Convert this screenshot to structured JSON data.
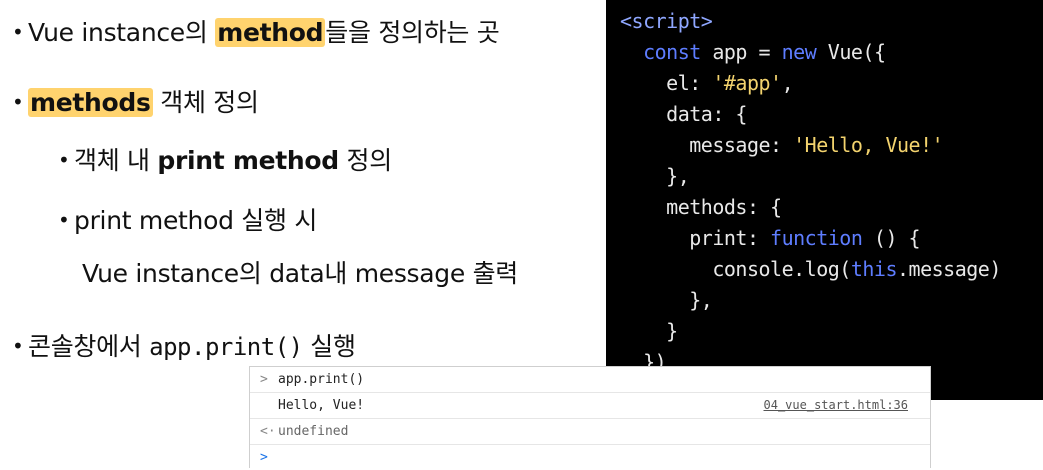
{
  "bullets": {
    "b1_pre": "Vue instance의 ",
    "b1_hl": "method",
    "b1_post": "들을 정의하는 곳",
    "b2_hl": "methods",
    "b2_post": " 객체 정의",
    "b3_pre": "객체 내 ",
    "b3_bold": "print method",
    "b3_post": " 정의",
    "b4": "print method 실행 시",
    "b4_cont": "Vue instance의 data내 message 출력",
    "b5_pre": "콘솔창에서 ",
    "b5_code": "app.print()",
    "b5_post": " 실행"
  },
  "code": {
    "l1": "<script>",
    "l2_kw1": "const",
    "l2_mid": " app = ",
    "l2_kw2": "new",
    "l2_end": " Vue({",
    "l3_key": "el: ",
    "l3_str": "'#app'",
    "l3_end": ",",
    "l4": "data: {",
    "l5_key": "message: ",
    "l5_str": "'Hello, Vue!'",
    "l6": "},",
    "l7": "methods: {",
    "l8_key": "print: ",
    "l8_kw": "function",
    "l8_end": " () {",
    "l9_pre": "console.log(",
    "l9_kw": "this",
    "l9_end": ".message)",
    "l10": "},",
    "l11": "}",
    "l12": "})"
  },
  "console": {
    "input_prompt": ">",
    "input": "app.print()",
    "output": "Hello, Vue!",
    "source_link": "04_vue_start.html:36",
    "return_prompt": "<·",
    "return_value": "undefined",
    "next_prompt": ">"
  },
  "colors": {
    "highlight": "#ffd36e",
    "code_bg": "#000000",
    "keyword": "#5e7dff",
    "string": "#f3d36e"
  }
}
